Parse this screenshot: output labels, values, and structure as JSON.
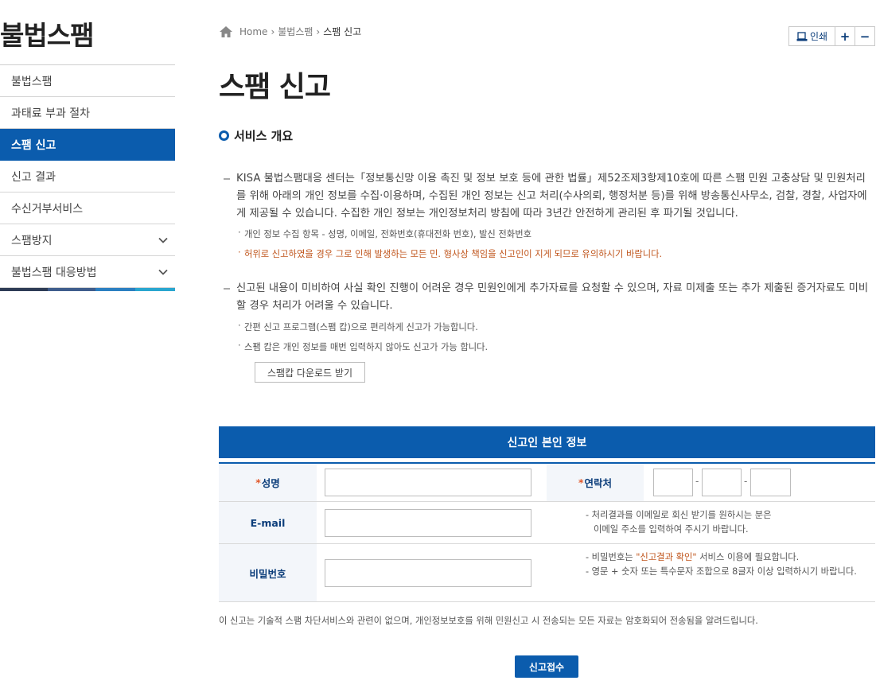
{
  "sidebar": {
    "title": "불법스팸",
    "items": [
      {
        "label": "불법스팸"
      },
      {
        "label": "과태료 부과 절차"
      },
      {
        "label": "스팸 신고"
      },
      {
        "label": "신고 결과"
      },
      {
        "label": "수신거부서비스"
      },
      {
        "label": "스팸방지"
      },
      {
        "label": "불법스팸 대응방법"
      }
    ]
  },
  "breadcrumb": {
    "home": "Home",
    "level1": "불법스팸",
    "current": "스팸 신고"
  },
  "util": {
    "print": "인쇄",
    "plus": "+",
    "minus": "−"
  },
  "page": {
    "title": "스팸 신고",
    "section_title": "서비스 개요"
  },
  "overview": {
    "para1": "KISA 불법스팸대응 센터는「정보통신망 이용 촉진 및 정보 보호 등에 관한 법률」제52조제3항제10호에 따른 스팸 민원 고충상담 및 민원처리를 위해 아래의 개인 정보를 수집·이용하며, 수집된 개인 정보는 신고 처리(수사의뢰, 행정처분 등)를 위해 방송통신사무소, 검찰, 경찰, 사업자에게 제공될 수 있습니다. 수집한 개인 정보는 개인정보처리 방침에 따라 3년간 안전하게 관리된 후 파기될 것입니다.",
    "note1": "개인 정보 수집 항목 - 성명, 이메일, 전화번호(휴대전화 번호), 발신 전화번호",
    "note2": "허위로 신고하였을 경우 그로 인해 발생하는 모든 민. 형사상 책임을 신고인이 지게 되므로 유의하시기 바랍니다.",
    "para2": "신고된 내용이 미비하여 사실 확인 진행이 어려운 경우 민원인에게 추가자료를 요청할 수 있으며, 자료 미제출 또는 추가 제출된 증거자료도 미비할 경우 처리가 어려울 수 있습니다.",
    "note3": "간편 신고 프로그램(스팸 캅)으로 편리하게 신고가 가능합니다.",
    "note4": "스팸 캅은 개인 정보를 매번 입력하지 않아도 신고가 가능 합니다.",
    "download_label": "스팸캅 다운로드 받기",
    "bullet": "·"
  },
  "form": {
    "header": "신고인 본인 정보",
    "required_mark": "*",
    "name_label": "성명",
    "name_value": "",
    "contact_label": "연락처",
    "phone": {
      "part1": "",
      "part2": "",
      "part3": "",
      "sep": "-"
    },
    "email_label": "E-mail",
    "email_value": "",
    "email_help1": "- 처리결과를 이메일로 회신 받기를 원하시는 분은",
    "email_help2": "이메일 주소를 입력하여 주시기 바랍니다.",
    "password_label": "비밀번호",
    "password_value": "",
    "pw_help1_prefix": "- 비밀번호는 ",
    "pw_help1_highlight": "\"신고결과 확인\"",
    "pw_help1_suffix": " 서비스 이용에 필요합니다.",
    "pw_help2": "- 영문 + 숫자 또는 특수문자 조합으로 8글자 이상 입력하시기 바랍니다."
  },
  "disclaimer": "이 신고는 기술적 스팸 차단서비스와 관련이 없으며, 개인정보보호를 위해 민원신고 시 전송되는 모든 자료는 암호화되어 전송됨을 알려드립니다.",
  "submit_label": "신고접수",
  "colors": {
    "accent": "#0b5cad",
    "warning": "#c0561d",
    "label_bg": "#f3f6fa"
  }
}
